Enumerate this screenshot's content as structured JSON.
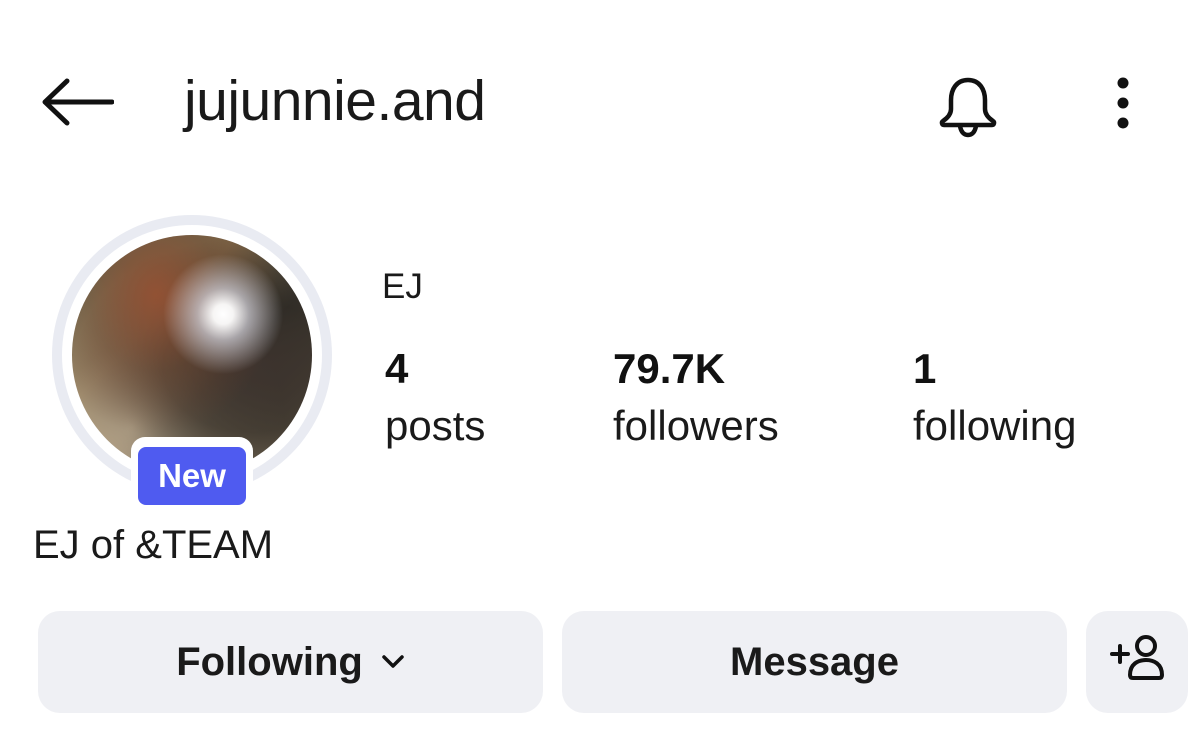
{
  "header": {
    "username": "jujunnie.and",
    "back_icon": "arrow-left-icon",
    "bell_icon": "bell-icon",
    "more_icon": "more-vertical-icon"
  },
  "profile": {
    "badge_label": "New",
    "display_name": "EJ",
    "bio_name": "EJ of &TEAM",
    "accent_color": "#4f5bf0"
  },
  "stats": {
    "posts": {
      "count": "4",
      "label": "posts"
    },
    "followers": {
      "count": "79.7K",
      "label": "followers"
    },
    "following": {
      "count": "1",
      "label": "following"
    }
  },
  "actions": {
    "following_label": "Following",
    "message_label": "Message",
    "add_user_icon": "add-user-icon",
    "chevron_icon": "chevron-down-icon"
  }
}
